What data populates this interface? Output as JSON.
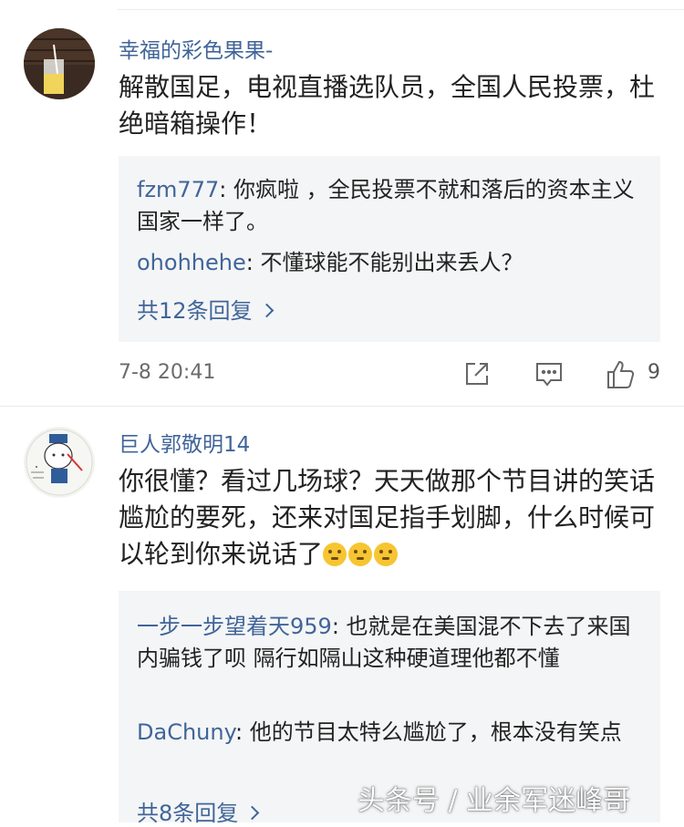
{
  "comments": [
    {
      "username": "幸福的彩色果果-",
      "text": "解散国足，电视直播选队员，全国人民投票，杜绝暗箱操作！",
      "replies": [
        {
          "name": "fzm777",
          "sep": ": ",
          "text": "你疯啦 ，全民投票不就和落后的资本主义国家一样了。"
        },
        {
          "name": "ohohhehe",
          "sep": ": ",
          "text": "不懂球能不能别出来丢人？"
        }
      ],
      "more_replies": "共12条回复",
      "time": "7-8 20:41",
      "like_count": "9"
    },
    {
      "username": "巨人郭敬明14",
      "text": "你很懂？看过几场球？天天做那个节目讲的笑话尴尬的要死，还来对国足指手划脚，什么时候可以轮到你来说话了",
      "replies": [
        {
          "name": "一步一步望着天959",
          "sep": ": ",
          "text": "也就是在美国混不下去了来国内骗钱了呗 隔行如隔山这种硬道理他都不懂"
        },
        {
          "name": "DaChuny",
          "sep": ": ",
          "text": "他的节目太特么尴尬了，根本没有笑点"
        }
      ],
      "more_replies": "共8条回复"
    }
  ],
  "icons": {
    "share": "share-icon",
    "comment": "comment-icon",
    "like": "thumbs-up-icon",
    "emoji": "thinking-face-emoji"
  },
  "colors": {
    "link": "#406599",
    "reply_bg": "#f4f5f6"
  },
  "watermark": "头条号 / 业余军迷峰哥"
}
